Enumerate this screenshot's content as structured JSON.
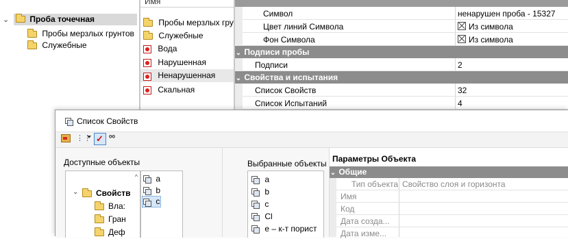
{
  "tree": {
    "root_label": "Проба точечная",
    "children": [
      "Пробы мерзлых грунтов",
      "Служебные"
    ]
  },
  "list": {
    "header": "Имя",
    "items": [
      {
        "label": "Пробы мерзлых грунтов",
        "icon": "folder-icon"
      },
      {
        "label": "Служебные",
        "icon": "folder-icon"
      },
      {
        "label": "Вода",
        "icon": "red-symbol-icon"
      },
      {
        "label": "Нарушенная",
        "icon": "red-symbol-icon"
      },
      {
        "label": "Ненарушенная",
        "icon": "red-symbol-icon"
      },
      {
        "label": "Скальная",
        "icon": "red-symbol-icon"
      }
    ]
  },
  "props": {
    "rows": [
      {
        "name": "Символ",
        "value": "ненарушен проба - 15327"
      },
      {
        "name": "Цвет линий Символа",
        "value": "Из символа"
      },
      {
        "name": "Фон Символа",
        "value": "Из символа"
      }
    ],
    "section1": "Подписи пробы",
    "section1_rows": [
      {
        "name": "Подписи",
        "value": "2"
      }
    ],
    "section2": "Свойства и испытания",
    "section2_rows": [
      {
        "name": "Список Свойств",
        "value": "32"
      },
      {
        "name": "Список Испытаний",
        "value": "4"
      }
    ]
  },
  "dialog": {
    "title": "Список Свойств",
    "available_label": "Доступные объекты",
    "available_tree": {
      "root": "Свойств",
      "children": [
        "Вла:",
        "Гран",
        "Деф"
      ]
    },
    "available_items": [
      "a",
      "b",
      "c"
    ],
    "selected_label": "Выбранные объекты",
    "selected_items": [
      "a",
      "b",
      "c",
      "Cl",
      "e – к-т порист"
    ],
    "params_label": "Параметры Объекта",
    "params_section": "Общие",
    "params_rows": [
      {
        "name": "Тип объекта",
        "value": "Свойство слоя и горизонта"
      },
      {
        "name": "Имя",
        "value": ""
      },
      {
        "name": "Код",
        "value": ""
      },
      {
        "name": "Дата созда...",
        "value": ""
      },
      {
        "name": "Дата изме...",
        "value": ""
      }
    ]
  }
}
